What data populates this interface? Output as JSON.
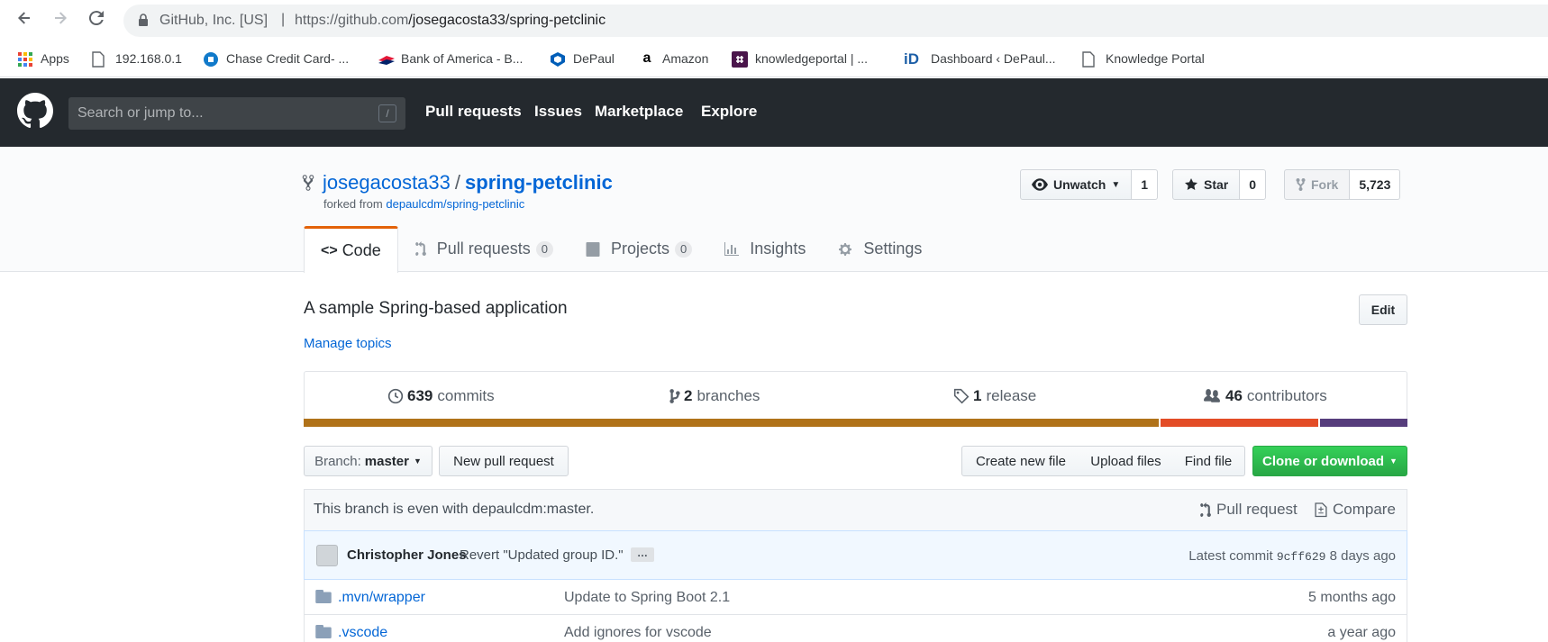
{
  "browser": {
    "site_identity": "GitHub, Inc. [US]",
    "url_prefix": "https://github.com",
    "url_path": "/josegacosta33/spring-petclinic",
    "separator": "|"
  },
  "bookmarks": [
    {
      "label": "Apps"
    },
    {
      "label": "192.168.0.1"
    },
    {
      "label": "Chase Credit Card- ..."
    },
    {
      "label": "Bank of America - B..."
    },
    {
      "label": "DePaul"
    },
    {
      "label": "Amazon"
    },
    {
      "label": "knowledgeportal | ..."
    },
    {
      "label": "Dashboard ‹ DePaul..."
    },
    {
      "label": "Knowledge Portal"
    }
  ],
  "header": {
    "search_placeholder": "Search or jump to...",
    "search_shortcut": "/",
    "nav": [
      "Pull requests",
      "Issues",
      "Marketplace",
      "Explore"
    ]
  },
  "repo": {
    "owner": "josegacosta33",
    "slash": "/",
    "name": "spring-petclinic",
    "forked_from_label": "forked from",
    "forked_from_link": "depaulcdm/spring-petclinic",
    "unwatch_label": "Unwatch",
    "watch_count": "1",
    "star_label": "Star",
    "star_count": "0",
    "fork_label": "Fork",
    "fork_count": "5,723"
  },
  "tabs": [
    {
      "label": "Code"
    },
    {
      "label": "Pull requests",
      "counter": "0"
    },
    {
      "label": "Projects",
      "counter": "0"
    },
    {
      "label": "Insights"
    },
    {
      "label": "Settings"
    }
  ],
  "description": "A sample Spring-based application",
  "manage_topics": "Manage topics",
  "edit_label": "Edit",
  "summary": {
    "commits_num": "639",
    "commits_label": "commits",
    "branches_num": "2",
    "branches_label": "branches",
    "releases_num": "1",
    "releases_label": "release",
    "contributors_num": "46",
    "contributors_label": "contributors"
  },
  "languages": [
    {
      "color": "#b07219",
      "share": 0.775
    },
    {
      "color": "#e34c26",
      "share": 0.144
    },
    {
      "color": "#563d7c",
      "share": 0.081
    }
  ],
  "file_nav": {
    "branch_label": "Branch:",
    "branch_name": "master",
    "new_pr": "New pull request",
    "create_file": "Create new file",
    "upload_files": "Upload files",
    "find_file": "Find file",
    "clone": "Clone or download"
  },
  "branch_info": {
    "message": "This branch is even with depaulcdm:master.",
    "pull_request": "Pull request",
    "compare": "Compare"
  },
  "latest_commit": {
    "author": "Christopher Jones",
    "message": "Revert \"Updated group ID.\"",
    "ellipsis": "…",
    "latest_label": "Latest commit",
    "sha": "9cff629",
    "age": "8 days ago"
  },
  "files": [
    {
      "name": ".mvn/wrapper",
      "message": "Update to Spring Boot 2.1",
      "age": "5 months ago"
    },
    {
      "name": ".vscode",
      "message": "Add ignores for vscode",
      "age": "a year ago"
    }
  ]
}
